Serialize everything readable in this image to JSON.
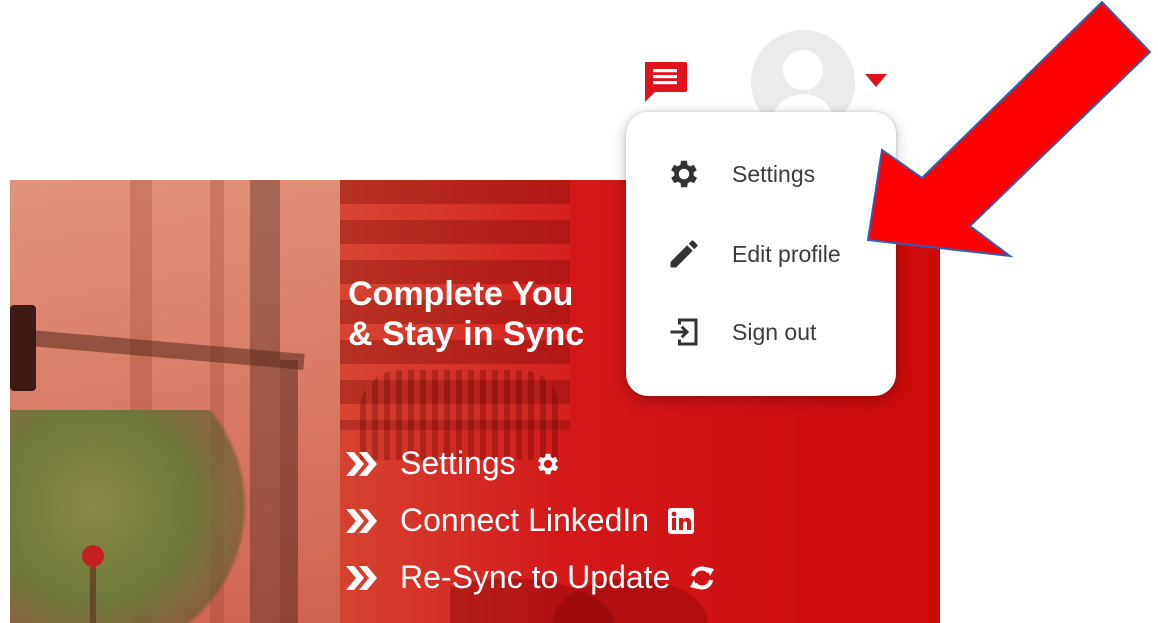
{
  "header": {
    "chat_icon": "chat-message-icon",
    "avatar_icon": "user-avatar-icon",
    "caret_icon": "caret-down-icon",
    "accent_color": "#e0121b"
  },
  "banner": {
    "headline_line1": "Complete You",
    "headline_line2": "& Stay in Sync",
    "items": [
      {
        "label": "Settings",
        "icon": "gear-icon"
      },
      {
        "label": "Connect LinkedIn",
        "icon": "linkedin-icon"
      },
      {
        "label": "Re-Sync to Update",
        "icon": "sync-icon"
      }
    ]
  },
  "menu": {
    "items": [
      {
        "label": "Settings",
        "icon": "gear-icon"
      },
      {
        "label": "Edit profile",
        "icon": "pencil-icon"
      },
      {
        "label": "Sign out",
        "icon": "sign-out-icon"
      }
    ]
  },
  "annotation": {
    "arrow_color": "#ff0000",
    "arrow_outline": "#2f5fb3"
  }
}
